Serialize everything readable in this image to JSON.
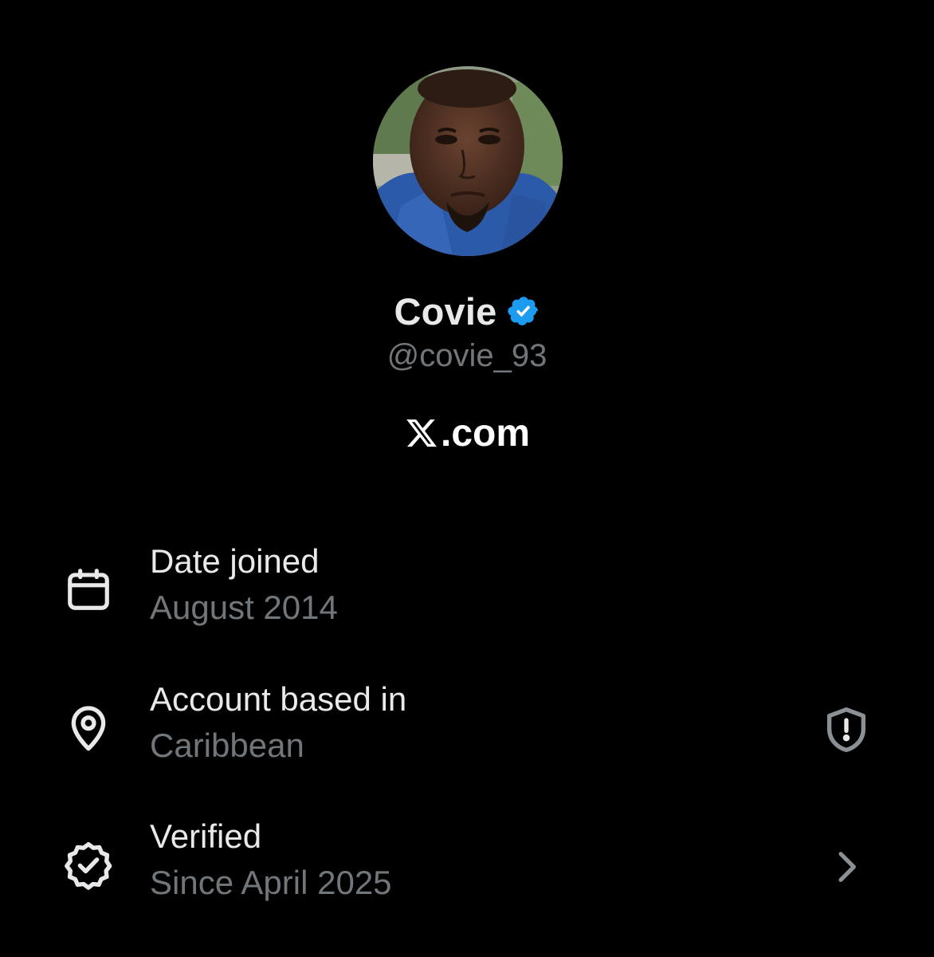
{
  "profile": {
    "display_name": "Covie",
    "handle": "@covie_93",
    "verified_badge_color": "#1d9bf0",
    "avatar_icon": "profile-photo"
  },
  "brand": {
    "text": ".com",
    "logo_icon": "x-logo"
  },
  "about_items": [
    {
      "title": "Date joined",
      "value": "August 2014",
      "icon": "calendar-icon"
    },
    {
      "title": "Account based in",
      "value": "Caribbean",
      "icon": "location-pin-icon",
      "trailing_icon": "shield-alert-icon"
    },
    {
      "title": "Verified",
      "value": "Since April 2025",
      "icon": "verified-badge-icon",
      "trailing_icon": "chevron-right-icon"
    }
  ],
  "colors": {
    "background": "#000000",
    "primary_text": "#e7e9ea",
    "secondary_text": "#71767b",
    "accent": "#1d9bf0"
  }
}
